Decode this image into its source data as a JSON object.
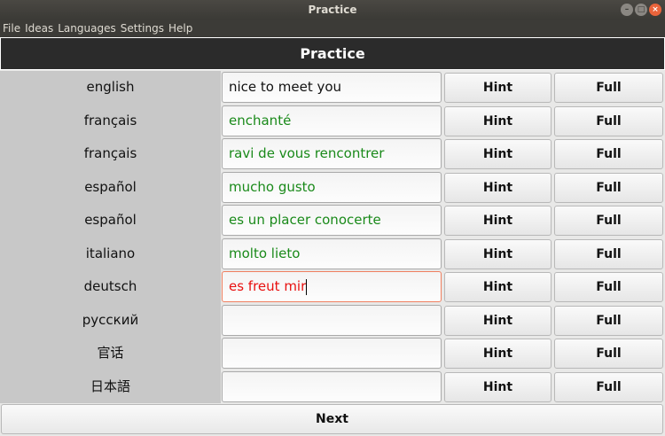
{
  "window": {
    "title": "Practice"
  },
  "menu": [
    "File",
    "Ideas",
    "Languages",
    "Settings",
    "Help"
  ],
  "header": "Practice",
  "buttons": {
    "hint": "Hint",
    "full": "Full",
    "next": "Next"
  },
  "colors": {
    "correct": "#1a8a1a",
    "wrong": "#e8100f"
  },
  "rows": [
    {
      "language": "english",
      "value": "nice to meet you",
      "state": "plain"
    },
    {
      "language": "français",
      "value": "enchanté",
      "state": "ok"
    },
    {
      "language": "français",
      "value": "ravi de vous rencontrer",
      "state": "ok"
    },
    {
      "language": "español",
      "value": "mucho gusto",
      "state": "ok"
    },
    {
      "language": "español",
      "value": "es un placer conocerte",
      "state": "ok"
    },
    {
      "language": "italiano",
      "value": "molto lieto",
      "state": "ok"
    },
    {
      "language": "deutsch",
      "value": "es freut mir",
      "state": "err"
    },
    {
      "language": "русский",
      "value": "",
      "state": "plain"
    },
    {
      "language": "官话",
      "value": "",
      "state": "plain"
    },
    {
      "language": "日本語",
      "value": "",
      "state": "plain"
    }
  ]
}
